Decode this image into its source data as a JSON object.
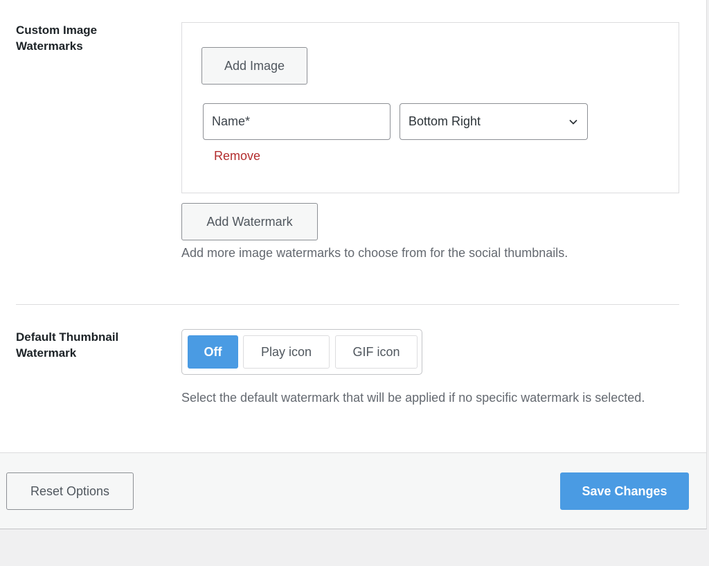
{
  "custom_watermarks": {
    "label": "Custom Image Watermarks",
    "add_image_label": "Add Image",
    "name_placeholder": "Name*",
    "position_value": "Bottom Right",
    "remove_label": "Remove",
    "add_watermark_label": "Add Watermark",
    "description": "Add more image watermarks to choose from for the social thumbnails."
  },
  "default_watermark": {
    "label": "Default Thumbnail Watermark",
    "options": [
      "Off",
      "Play icon",
      "GIF icon"
    ],
    "selected": "Off",
    "description": "Select the default watermark that will be applied if no specific watermark is selected."
  },
  "footer": {
    "reset_label": "Reset Options",
    "save_label": "Save Changes"
  },
  "colors": {
    "accent": "#4a9be3",
    "danger": "#b32d2e"
  },
  "icons": {
    "select_arrow": "chevron-down-icon"
  }
}
